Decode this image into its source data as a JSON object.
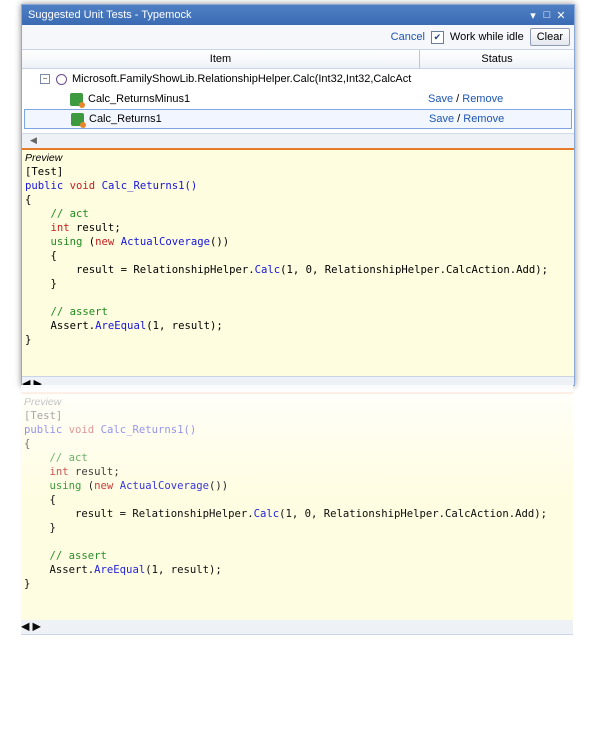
{
  "window": {
    "title": "Suggested Unit Tests - Typemock"
  },
  "toolbar": {
    "cancel": "Cancel",
    "work_while_idle": "Work while idle",
    "clear": "Clear"
  },
  "columns": {
    "item": "Item",
    "status": "Status"
  },
  "tree": {
    "parent": "Microsoft.FamilyShowLib.RelationshipHelper.Calc(Int32,Int32,CalcAct",
    "items": [
      {
        "name": "Calc_ReturnsMinus1",
        "save": "Save",
        "sep": " / ",
        "remove": "Remove"
      },
      {
        "name": "Calc_Returns1",
        "save": "Save",
        "sep": " / ",
        "remove": "Remove"
      }
    ]
  },
  "preview": {
    "heading": "Preview",
    "attr": "[Test]",
    "kw_public": "public",
    "kw_void": "void",
    "method": "Calc_Returns1()",
    "brace_open": "{",
    "comment_act": "// act",
    "kw_int": "int",
    "var_result": "result;",
    "kw_using": "using",
    "kw_new": "new",
    "type_coverage": "ActualCoverage",
    "coverage_rest": "())",
    "line_assign_pre": "result = RelationshipHelper.",
    "calc_fn": "Calc",
    "line_assign_post": "(1, 0, RelationshipHelper.CalcAction.Add);",
    "comment_assert": "// assert",
    "assert_pre": "Assert.",
    "assert_fn": "AreEqual",
    "assert_post": "(1, result);",
    "brace_close": "}"
  }
}
